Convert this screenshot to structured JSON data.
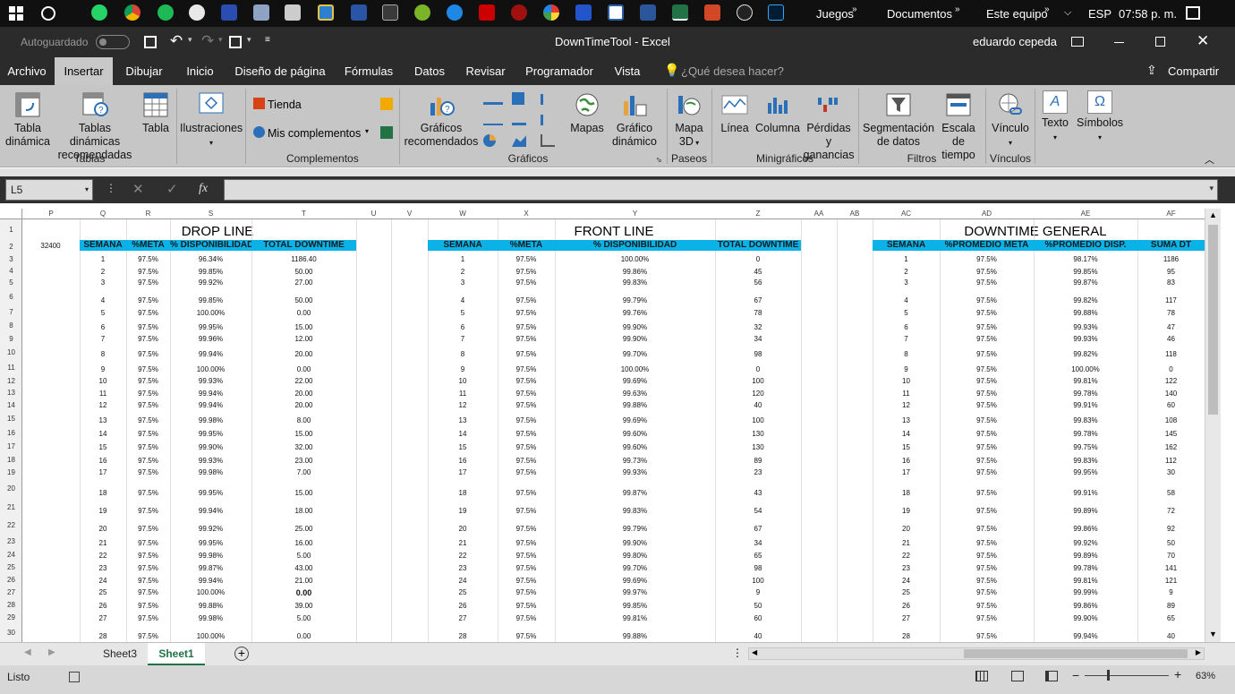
{
  "taskbar": {
    "items": [
      "Juegos",
      "Documentos",
      "Este equipo",
      "ESP",
      "07:58 p. m."
    ]
  },
  "window": {
    "title": "DownTimeTool - Excel",
    "autosave": "Autoguardado",
    "user": "eduardo cepeda"
  },
  "menu": {
    "tabs": [
      "Archivo",
      "Insertar",
      "Dibujar",
      "Inicio",
      "Diseño de página",
      "Fórmulas",
      "Datos",
      "Revisar",
      "Programador",
      "Vista"
    ],
    "active": "Insertar",
    "search": "¿Qué desea hacer?",
    "share": "Compartir"
  },
  "ribbon": {
    "tablas": {
      "tabla_dinamica": [
        "Tabla",
        "dinámica"
      ],
      "recomendadas": [
        "Tablas dinámicas",
        "recomendadas"
      ],
      "tabla": "Tabla",
      "group": "Tablas"
    },
    "ilustraciones": "Ilustraciones",
    "complementos": {
      "tienda": "Tienda",
      "mis": "Mis complementos",
      "group": "Complementos"
    },
    "graficos": {
      "recomendados": [
        "Gráficos",
        "recomendados"
      ],
      "mapas": "Mapas",
      "dinamico": [
        "Gráfico",
        "dinámico"
      ],
      "group": "Gráficos"
    },
    "paseos": {
      "mapa3d": [
        "Mapa",
        "3D"
      ],
      "group": "Paseos"
    },
    "minigraficos": {
      "linea": "Línea",
      "columna": "Columna",
      "perdidas": [
        "Pérdidas y",
        "ganancias"
      ],
      "group": "Minigráficos"
    },
    "filtros": {
      "segmentacion": [
        "Segmentación",
        "de datos"
      ],
      "escala": [
        "Escala de",
        "tiempo"
      ],
      "group": "Filtros"
    },
    "vinculos": {
      "vinculo": "Vínculo",
      "group": "Vínculos"
    },
    "texto": "Texto",
    "simbolos": "Símbolos"
  },
  "formula_bar": {
    "name_box": "L5",
    "fx": "fx",
    "value": ""
  },
  "columns": [
    "P",
    "Q",
    "R",
    "S",
    "T",
    "U",
    "V",
    "W",
    "X",
    "Y",
    "Z",
    "AA",
    "AB",
    "AC",
    "AD",
    "AE",
    "AF"
  ],
  "rows": [
    "1",
    "2",
    "3",
    "4",
    "5",
    "6",
    "7",
    "8",
    "9",
    "10",
    "11",
    "12",
    "13",
    "14",
    "15",
    "16",
    "17",
    "18",
    "19",
    "20",
    "21",
    "22",
    "23",
    "24",
    "25",
    "26",
    "27",
    "28",
    "29",
    "30"
  ],
  "p2": "32400",
  "drop_line": {
    "title": "DROP LINE",
    "headers": [
      "SEMANA",
      "%META",
      "% DISPONIBILIDAD",
      "TOTAL DOWNTIME"
    ],
    "rows": [
      [
        "1",
        "97.5%",
        "96.34%",
        "1186.40"
      ],
      [
        "2",
        "97.5%",
        "99.85%",
        "50.00"
      ],
      [
        "3",
        "97.5%",
        "99.92%",
        "27.00"
      ],
      [
        "4",
        "97.5%",
        "99.85%",
        "50.00"
      ],
      [
        "5",
        "97.5%",
        "100.00%",
        "0.00"
      ],
      [
        "6",
        "97.5%",
        "99.95%",
        "15.00"
      ],
      [
        "7",
        "97.5%",
        "99.96%",
        "12.00"
      ],
      [
        "8",
        "97.5%",
        "99.94%",
        "20.00"
      ],
      [
        "9",
        "97.5%",
        "100.00%",
        "0.00"
      ],
      [
        "10",
        "97.5%",
        "99.93%",
        "22.00"
      ],
      [
        "11",
        "97.5%",
        "99.94%",
        "20.00"
      ],
      [
        "12",
        "97.5%",
        "99.94%",
        "20.00"
      ],
      [
        "13",
        "97.5%",
        "99.98%",
        "8.00"
      ],
      [
        "14",
        "97.5%",
        "99.95%",
        "15.00"
      ],
      [
        "15",
        "97.5%",
        "99.90%",
        "32.00"
      ],
      [
        "16",
        "97.5%",
        "99.93%",
        "23.00"
      ],
      [
        "17",
        "97.5%",
        "99.98%",
        "7.00"
      ],
      [
        "18",
        "97.5%",
        "99.95%",
        "15.00"
      ],
      [
        "19",
        "97.5%",
        "99.94%",
        "18.00"
      ],
      [
        "20",
        "97.5%",
        "99.92%",
        "25.00"
      ],
      [
        "21",
        "97.5%",
        "99.95%",
        "16.00"
      ],
      [
        "22",
        "97.5%",
        "99.98%",
        "5.00"
      ],
      [
        "23",
        "97.5%",
        "99.87%",
        "43.00"
      ],
      [
        "24",
        "97.5%",
        "99.94%",
        "21.00"
      ],
      [
        "25",
        "97.5%",
        "100.00%",
        "0.00"
      ],
      [
        "26",
        "97.5%",
        "99.88%",
        "39.00"
      ],
      [
        "27",
        "97.5%",
        "99.98%",
        "5.00"
      ],
      [
        "28",
        "97.5%",
        "100.00%",
        "0.00"
      ]
    ]
  },
  "front_line": {
    "title": "FRONT LINE",
    "headers": [
      "SEMANA",
      "%META",
      "% DISPONIBILIDAD",
      "TOTAL DOWNTIME"
    ],
    "rows": [
      [
        "1",
        "97.5%",
        "100.00%",
        "0"
      ],
      [
        "2",
        "97.5%",
        "99.86%",
        "45"
      ],
      [
        "3",
        "97.5%",
        "99.83%",
        "56"
      ],
      [
        "4",
        "97.5%",
        "99.79%",
        "67"
      ],
      [
        "5",
        "97.5%",
        "99.76%",
        "78"
      ],
      [
        "6",
        "97.5%",
        "99.90%",
        "32"
      ],
      [
        "7",
        "97.5%",
        "99.90%",
        "34"
      ],
      [
        "8",
        "97.5%",
        "99.70%",
        "98"
      ],
      [
        "9",
        "97.5%",
        "100.00%",
        "0"
      ],
      [
        "10",
        "97.5%",
        "99.69%",
        "100"
      ],
      [
        "11",
        "97.5%",
        "99.63%",
        "120"
      ],
      [
        "12",
        "97.5%",
        "99.88%",
        "40"
      ],
      [
        "13",
        "97.5%",
        "99.69%",
        "100"
      ],
      [
        "14",
        "97.5%",
        "99.60%",
        "130"
      ],
      [
        "15",
        "97.5%",
        "99.60%",
        "130"
      ],
      [
        "16",
        "97.5%",
        "99.73%",
        "89"
      ],
      [
        "17",
        "97.5%",
        "99.93%",
        "23"
      ],
      [
        "18",
        "97.5%",
        "99.87%",
        "43"
      ],
      [
        "19",
        "97.5%",
        "99.83%",
        "54"
      ],
      [
        "20",
        "97.5%",
        "99.79%",
        "67"
      ],
      [
        "21",
        "97.5%",
        "99.90%",
        "34"
      ],
      [
        "22",
        "97.5%",
        "99.80%",
        "65"
      ],
      [
        "23",
        "97.5%",
        "99.70%",
        "98"
      ],
      [
        "24",
        "97.5%",
        "99.69%",
        "100"
      ],
      [
        "25",
        "97.5%",
        "99.97%",
        "9"
      ],
      [
        "26",
        "97.5%",
        "99.85%",
        "50"
      ],
      [
        "27",
        "97.5%",
        "99.81%",
        "60"
      ],
      [
        "28",
        "97.5%",
        "99.88%",
        "40"
      ]
    ]
  },
  "downtime_general": {
    "title": "DOWNTIME GENERAL",
    "headers": [
      "SEMANA",
      "%PROMEDIO META",
      "%PROMEDIO DISP.",
      "SUMA DT"
    ],
    "rows": [
      [
        "1",
        "97.5%",
        "98.17%",
        "1186"
      ],
      [
        "2",
        "97.5%",
        "99.85%",
        "95"
      ],
      [
        "3",
        "97.5%",
        "99.87%",
        "83"
      ],
      [
        "4",
        "97.5%",
        "99.82%",
        "117"
      ],
      [
        "5",
        "97.5%",
        "99.88%",
        "78"
      ],
      [
        "6",
        "97.5%",
        "99.93%",
        "47"
      ],
      [
        "7",
        "97.5%",
        "99.93%",
        "46"
      ],
      [
        "8",
        "97.5%",
        "99.82%",
        "118"
      ],
      [
        "9",
        "97.5%",
        "100.00%",
        "0"
      ],
      [
        "10",
        "97.5%",
        "99.81%",
        "122"
      ],
      [
        "11",
        "97.5%",
        "99.78%",
        "140"
      ],
      [
        "12",
        "97.5%",
        "99.91%",
        "60"
      ],
      [
        "13",
        "97.5%",
        "99.83%",
        "108"
      ],
      [
        "14",
        "97.5%",
        "99.78%",
        "145"
      ],
      [
        "15",
        "97.5%",
        "99.75%",
        "162"
      ],
      [
        "16",
        "97.5%",
        "99.83%",
        "112"
      ],
      [
        "17",
        "97.5%",
        "99.95%",
        "30"
      ],
      [
        "18",
        "97.5%",
        "99.91%",
        "58"
      ],
      [
        "19",
        "97.5%",
        "99.89%",
        "72"
      ],
      [
        "20",
        "97.5%",
        "99.86%",
        "92"
      ],
      [
        "21",
        "97.5%",
        "99.92%",
        "50"
      ],
      [
        "22",
        "97.5%",
        "99.89%",
        "70"
      ],
      [
        "23",
        "97.5%",
        "99.78%",
        "141"
      ],
      [
        "24",
        "97.5%",
        "99.81%",
        "121"
      ],
      [
        "25",
        "97.5%",
        "99.99%",
        "9"
      ],
      [
        "26",
        "97.5%",
        "99.86%",
        "89"
      ],
      [
        "27",
        "97.5%",
        "99.90%",
        "65"
      ],
      [
        "28",
        "97.5%",
        "99.94%",
        "40"
      ]
    ]
  },
  "sheets": [
    "Sheet3",
    "Sheet1"
  ],
  "active_sheet": "Sheet1",
  "status": {
    "text": "Listo",
    "zoom": "63%"
  }
}
